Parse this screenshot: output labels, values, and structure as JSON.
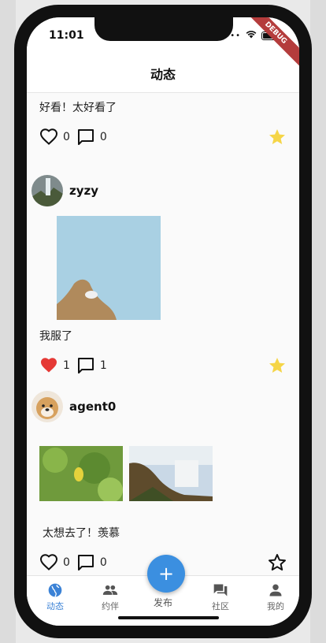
{
  "status": {
    "time": "11:01",
    "debug_label": "DEBUG"
  },
  "app_bar": {
    "title": "动态"
  },
  "posts": [
    {
      "text": "好看！太好看了",
      "likes": "0",
      "comments": "0",
      "liked": false,
      "starred": true
    },
    {
      "user": "zyzy",
      "text": "我服了",
      "likes": "1",
      "comments": "1",
      "liked": true,
      "starred": true
    },
    {
      "user": "agent0",
      "text": "太想去了！羡慕",
      "likes": "0",
      "comments": "0",
      "liked": false,
      "starred": false
    }
  ],
  "nav": {
    "items": [
      {
        "label": "动态",
        "icon": "globe-icon",
        "active": true
      },
      {
        "label": "约伴",
        "icon": "people-icon",
        "active": false
      },
      {
        "label": "发布",
        "icon": "plus-icon",
        "active": false
      },
      {
        "label": "社区",
        "icon": "forum-icon",
        "active": false
      },
      {
        "label": "我的",
        "icon": "person-icon",
        "active": false
      }
    ],
    "fab_symbol": "+"
  },
  "colors": {
    "accent": "#3b82d6",
    "like": "#e53935",
    "star": "#f5d547",
    "fab": "#3b8fe0"
  }
}
